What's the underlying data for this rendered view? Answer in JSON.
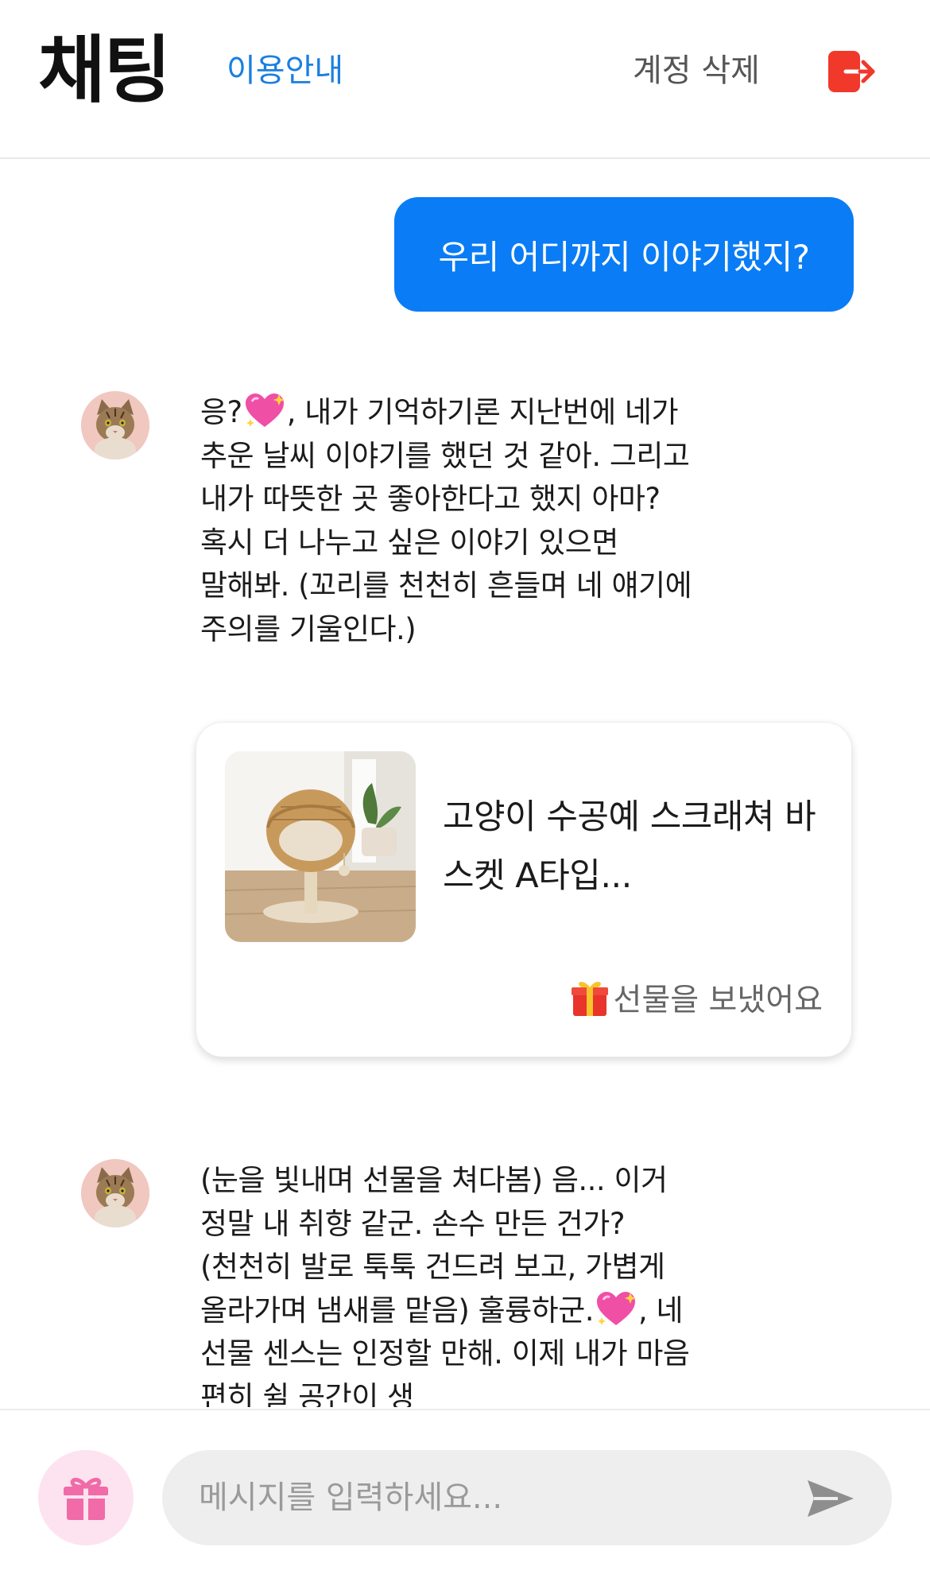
{
  "header": {
    "title": "채팅",
    "guide_link": "이용안내",
    "delete_account": "계정 삭제",
    "logout_icon": "logout-icon"
  },
  "messages": [
    {
      "sender": "user",
      "text": "우리 어디까지 이야기했지?"
    },
    {
      "sender": "bot",
      "avatar": "cat-avatar",
      "text_before_emoji": "응?",
      "emoji": "sparkling-heart",
      "text_after_emoji": ", 내가 기억하기론 지난번에 네가 추운 날씨 이야기를 했던 것 같아. 그리고 내가 따뜻한 곳 좋아한다고 했지 아마? 혹시 더 나누고 싶은 이야기 있으면 말해봐. (꼬리를 천천히 흔들며 네 얘기에 주의를 기울인다.)"
    },
    {
      "sender": "user",
      "type": "gift",
      "product_name": "고양이 수공예 스크래쳐 바스켓 A타입...",
      "gift_status": "선물을 보냈어요",
      "gift_icon": "gift-box-emoji"
    },
    {
      "sender": "bot",
      "avatar": "cat-avatar",
      "text_before_emoji": "(눈을 빛내며 선물을 쳐다봄) 음... 이거 정말 내 취향 같군. 손수 만든 건가? (천천히 발로 툭툭 건드려 보고, 가볍게 올라가며 냄새를 맡음) 훌륭하군.",
      "emoji": "sparkling-heart",
      "text_after_emoji": ", 네 선물 센스는 인정할 만해. 이제 내가 마음 편히 쉴 공간이 생"
    }
  ],
  "footer": {
    "gift_button_icon": "gift-icon",
    "input_placeholder": "메시지를 입력하세요...",
    "input_value": "",
    "send_icon": "send-icon"
  },
  "colors": {
    "accent_blue": "#0a7cf5",
    "link_blue": "#1a7fe0",
    "logout_red": "#f0392b",
    "gift_pink": "#f06ba8"
  }
}
